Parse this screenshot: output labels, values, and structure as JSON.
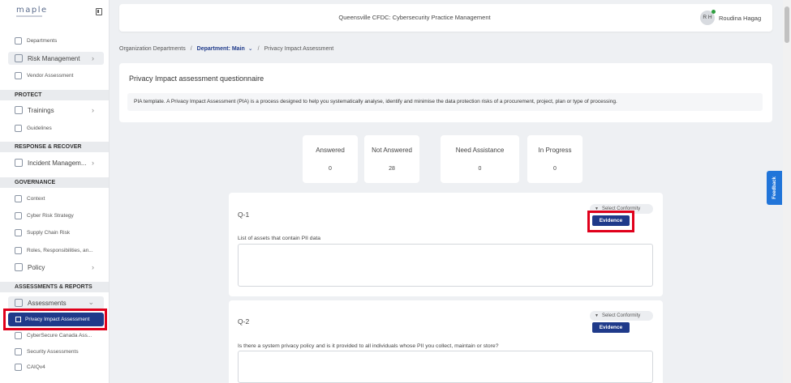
{
  "brand": {
    "logo_text": "maple"
  },
  "sidebar": {
    "top_items": [
      {
        "label": "Departments",
        "icon": "departments-icon"
      },
      {
        "label": "Risk Management",
        "icon": "risk-icon"
      },
      {
        "label": "Vendor Assessment",
        "icon": "vendor-icon"
      }
    ],
    "sections": [
      {
        "title": "PROTECT",
        "items": [
          {
            "label": "Trainings"
          },
          {
            "label": "Guidelines"
          }
        ]
      },
      {
        "title": "RESPONSE & RECOVER",
        "items": [
          {
            "label": "Incident Managem..."
          }
        ]
      },
      {
        "title": "GOVERNANCE",
        "items": [
          {
            "label": "Context"
          },
          {
            "label": "Cyber Risk Strategy"
          },
          {
            "label": "Supply Chain Risk"
          },
          {
            "label": "Roles, Responsibilities, an..."
          },
          {
            "label": "Policy"
          }
        ]
      },
      {
        "title": "ASSESSMENTS & REPORTS",
        "items": [
          {
            "label": "Assessments"
          },
          {
            "label": "Privacy Impact Assessment"
          },
          {
            "label": "CyberSecure Canada Ass..."
          },
          {
            "label": "Security Assessments"
          },
          {
            "label": "CAIQv4"
          }
        ]
      }
    ]
  },
  "topbar": {
    "title": "Queensville CFDC: Cybersecurity Practice Management",
    "avatar_initials": "R H",
    "user_name": "Roudina Hagag"
  },
  "breadcrumb": {
    "root": "Organization Departments",
    "department": "Department: Main",
    "current": "Privacy Impact Assessment"
  },
  "questionnaire": {
    "title": "Privacy Impact assessment questionnaire",
    "description": "PIA template. A Privacy Impact Assessment (PIA) is a process designed to help you systematically analyse, identify and minimise the data protection risks of a procurement, project, plan or type of processing."
  },
  "stats": [
    {
      "label": "Answered",
      "value": "0"
    },
    {
      "label": "Not Answered",
      "value": "28"
    },
    {
      "label": "Need Assistance",
      "value": "0"
    },
    {
      "label": "In Progress",
      "value": "0"
    }
  ],
  "questions": [
    {
      "number": "Q-1",
      "text": "List of assets that contain PII data",
      "conformity_label": "Select Conformity",
      "evidence_label": "Evidence"
    },
    {
      "number": "Q-2",
      "text": "Is there a system privacy policy and is it provided to all individuals whose PII you collect, maintain or store?",
      "conformity_label": "Select Conformity",
      "evidence_label": "Evidence"
    }
  ],
  "feedback_label": "Feedback",
  "colors": {
    "primary": "#1f3a8a",
    "highlight": "#e0001b",
    "feedback": "#2175d9"
  }
}
